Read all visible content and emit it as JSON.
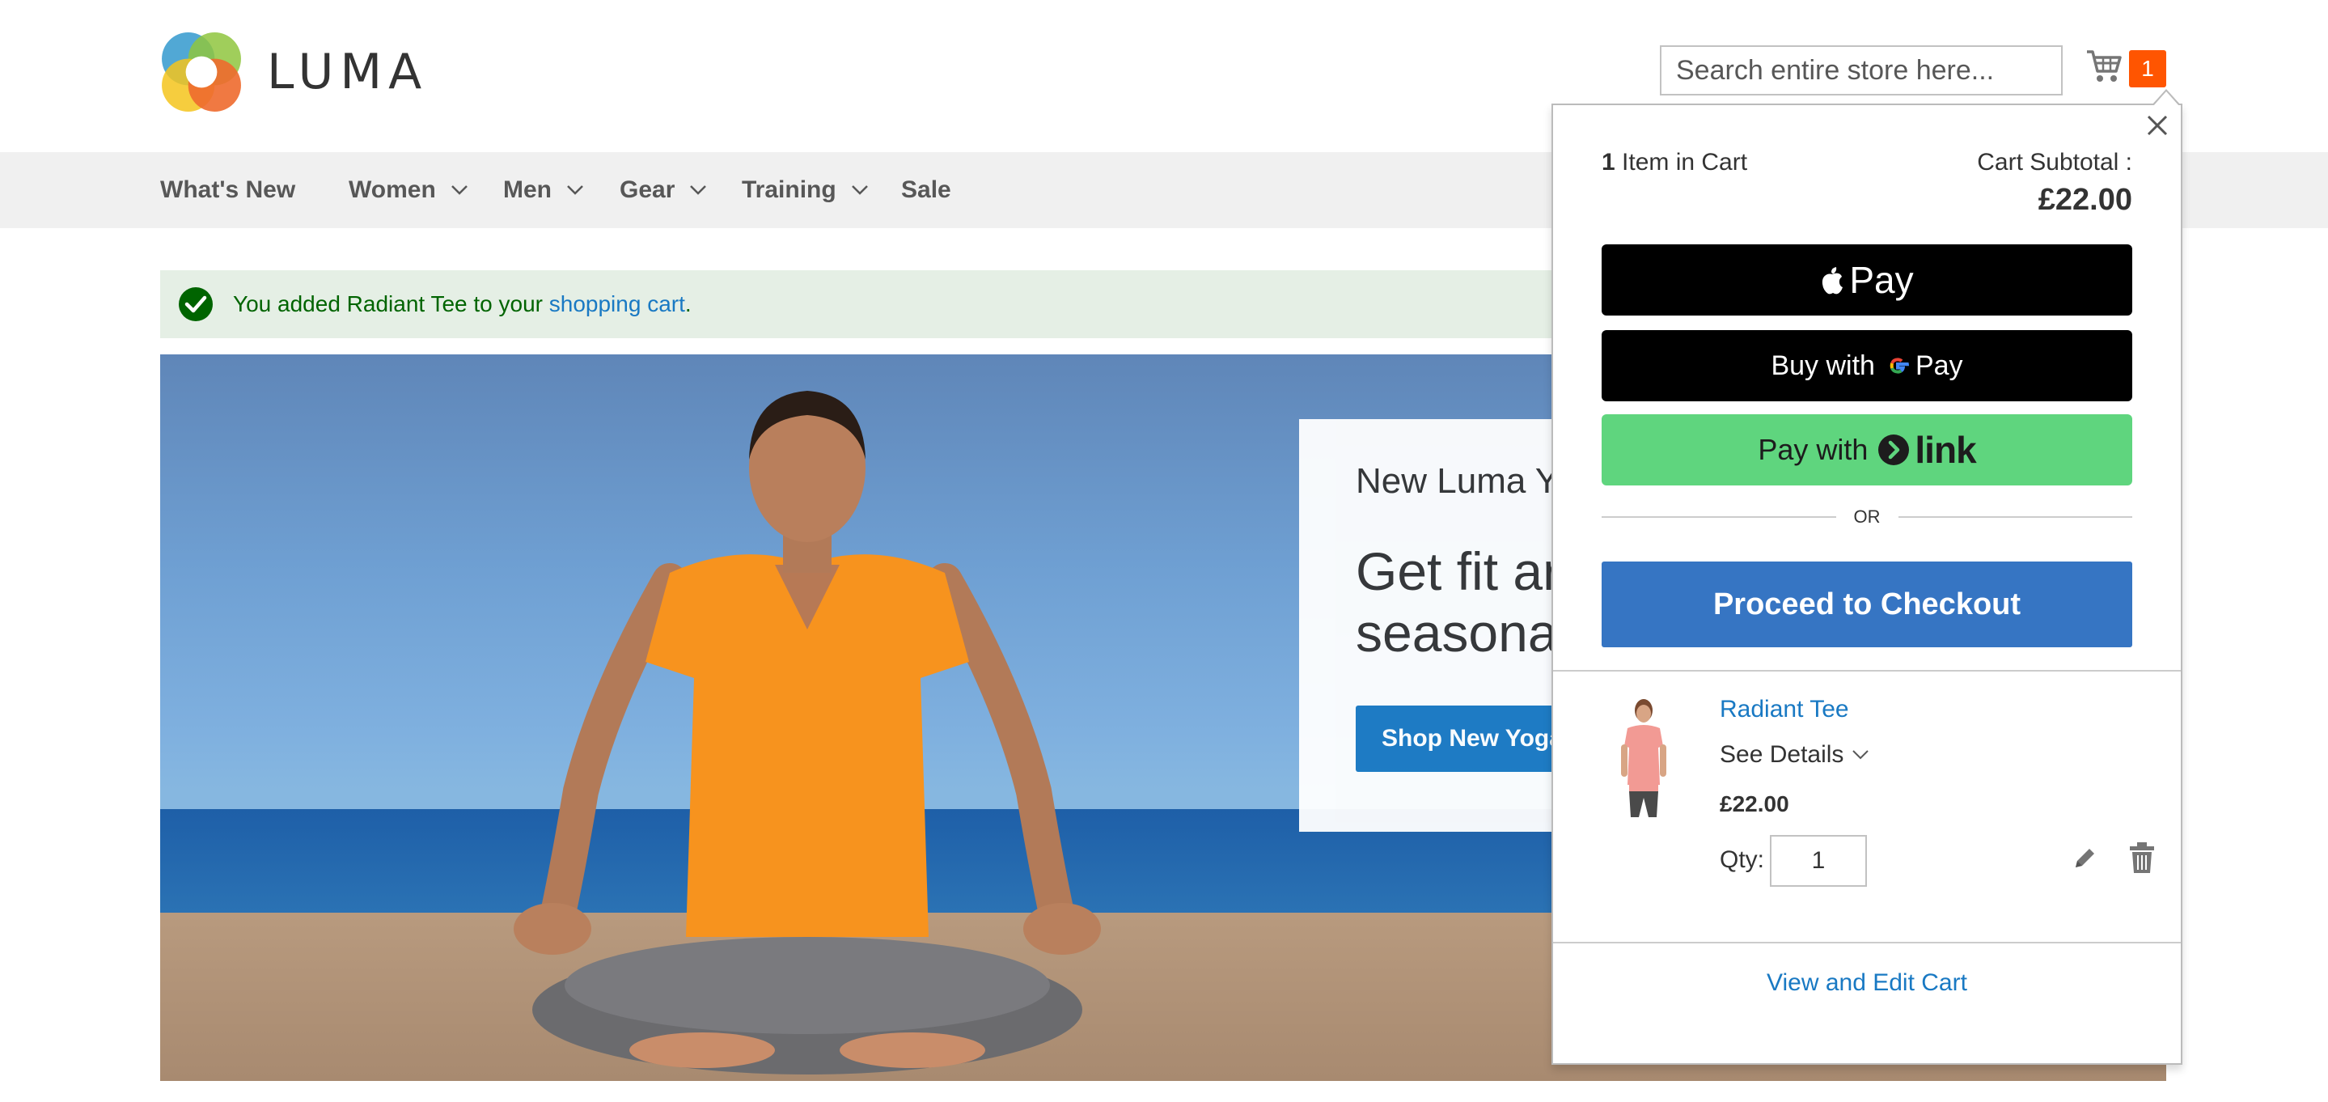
{
  "brand": {
    "name": "LUMA"
  },
  "search": {
    "placeholder": "Search entire store here..."
  },
  "cart": {
    "count": "1"
  },
  "nav": {
    "items": [
      {
        "label": "What's New",
        "has_dropdown": false
      },
      {
        "label": "Women",
        "has_dropdown": true
      },
      {
        "label": "Men",
        "has_dropdown": true
      },
      {
        "label": "Gear",
        "has_dropdown": true
      },
      {
        "label": "Training",
        "has_dropdown": true
      },
      {
        "label": "Sale",
        "has_dropdown": false
      }
    ]
  },
  "message": {
    "prefix": "You added Radiant Tee to your ",
    "link": "shopping cart",
    "suffix": "."
  },
  "hero": {
    "line1": "New Luma Y",
    "line2a": "Get fit ar",
    "line2b": "seasona",
    "button": "Shop New Yoga"
  },
  "minicart": {
    "count_number": "1",
    "count_label": " Item in Cart",
    "subtotal_label": "Cart Subtotal :",
    "subtotal": "£22.00",
    "apple_pay": "Pay",
    "google_pay_prefix": "Buy with",
    "google_pay_suffix": "Pay",
    "link_prefix": "Pay with",
    "link_word": "link",
    "or": "OR",
    "checkout": "Proceed to Checkout",
    "item": {
      "name": "Radiant Tee",
      "see_details": "See Details",
      "price": "£22.00",
      "qty_label": "Qty:",
      "qty": "1"
    },
    "view_cart": "View and Edit Cart"
  },
  "colors": {
    "accent": "#1979c3",
    "cart_badge": "#ff5501",
    "checkout": "#3675c3",
    "link_pay": "#5fd57e",
    "success_bg": "#e5efe5"
  }
}
